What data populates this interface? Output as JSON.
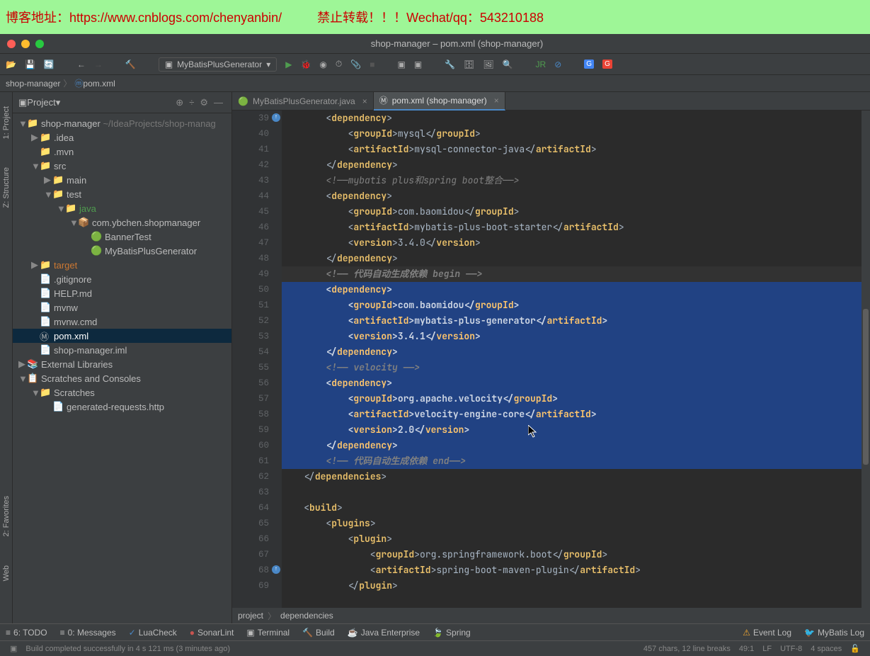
{
  "watermark": {
    "left": "博客地址：https://www.cnblogs.com/chenyanbin/",
    "right": "禁止转载！！！Wechat/qq：543210188"
  },
  "window_title": "shop-manager – pom.xml (shop-manager)",
  "run_config": "MyBatisPlusGenerator",
  "breadcrumb": {
    "root": "shop-manager",
    "file": "pom.xml"
  },
  "project_panel_title": "Project",
  "tree": [
    {
      "depth": 0,
      "arrow": "▼",
      "icon": "📁",
      "label": "shop-manager",
      "suffix": "  ~/IdeaProjects/shop-manag"
    },
    {
      "depth": 1,
      "arrow": "▶",
      "icon": "📁",
      "label": ".idea"
    },
    {
      "depth": 1,
      "arrow": "",
      "icon": "📁",
      "label": ".mvn"
    },
    {
      "depth": 1,
      "arrow": "▼",
      "icon": "📁",
      "label": "src"
    },
    {
      "depth": 2,
      "arrow": "▶",
      "icon": "📁",
      "label": "main"
    },
    {
      "depth": 2,
      "arrow": "▼",
      "icon": "📁",
      "label": "test"
    },
    {
      "depth": 3,
      "arrow": "▼",
      "icon": "📁",
      "label": "java",
      "green": true
    },
    {
      "depth": 4,
      "arrow": "▼",
      "icon": "📦",
      "label": "com.ybchen.shopmanager"
    },
    {
      "depth": 5,
      "arrow": "",
      "icon": "🟢",
      "label": "BannerTest"
    },
    {
      "depth": 5,
      "arrow": "",
      "icon": "🟢",
      "label": "MyBatisPlusGenerator"
    },
    {
      "depth": 1,
      "arrow": "▶",
      "icon": "📁",
      "label": "target",
      "orange": true
    },
    {
      "depth": 1,
      "arrow": "",
      "icon": "📄",
      "label": ".gitignore"
    },
    {
      "depth": 1,
      "arrow": "",
      "icon": "📄",
      "label": "HELP.md"
    },
    {
      "depth": 1,
      "arrow": "",
      "icon": "📄",
      "label": "mvnw"
    },
    {
      "depth": 1,
      "arrow": "",
      "icon": "📄",
      "label": "mvnw.cmd"
    },
    {
      "depth": 1,
      "arrow": "",
      "icon": "Ⓜ",
      "label": "pom.xml",
      "sel": true
    },
    {
      "depth": 1,
      "arrow": "",
      "icon": "📄",
      "label": "shop-manager.iml"
    },
    {
      "depth": 0,
      "arrow": "▶",
      "icon": "📚",
      "label": "External Libraries"
    },
    {
      "depth": 0,
      "arrow": "▼",
      "icon": "📋",
      "label": "Scratches and Consoles"
    },
    {
      "depth": 1,
      "arrow": "▼",
      "icon": "📁",
      "label": "Scratches"
    },
    {
      "depth": 2,
      "arrow": "",
      "icon": "📄",
      "label": "generated-requests.http"
    }
  ],
  "tabs": [
    {
      "label": "MyBatisPlusGenerator.java",
      "active": false,
      "icon": "🟢"
    },
    {
      "label": "pom.xml (shop-manager)",
      "active": true,
      "icon": "Ⓜ"
    }
  ],
  "code_lines": [
    {
      "n": 39,
      "mk": true,
      "html": "        <<1>dependency<0>>"
    },
    {
      "n": 40,
      "html": "            <<1>groupId<0>>mysql</<1>groupId<0>>"
    },
    {
      "n": 41,
      "html": "            <<1>artifactId<0>>mysql-connector-java</<1>artifactId<0>>"
    },
    {
      "n": 42,
      "html": "        </<1>dependency<0>>"
    },
    {
      "n": 43,
      "html": "        <2><!——mybatis plus和spring boot整合——><0>"
    },
    {
      "n": 44,
      "html": "        <<1>dependency<0>>"
    },
    {
      "n": 45,
      "html": "            <<1>groupId<0>>com.baomidou</<1>groupId<0>>"
    },
    {
      "n": 46,
      "html": "            <<1>artifactId<0>>mybatis-plus-boot-starter</<1>artifactId<0>>"
    },
    {
      "n": 47,
      "html": "            <<1>version<0>>3.4.0</<1>version<0>>"
    },
    {
      "n": 48,
      "html": "        </<1>dependency<0>>"
    },
    {
      "n": 49,
      "sel": true,
      "hl": true,
      "html": "        <2><!—— 代码自动生成依赖 begin ——><0>"
    },
    {
      "n": 50,
      "sel": true,
      "html": "        <<1>dependency<0>>"
    },
    {
      "n": 51,
      "sel": true,
      "html": "            <<1>groupId<0>>com.baomidou</<1>groupId<0>>"
    },
    {
      "n": 52,
      "sel": true,
      "html": "            <<1>artifactId<0>>mybatis-plus-generator</<1>artifactId<0>>"
    },
    {
      "n": 53,
      "sel": true,
      "html": "            <<1>version<0>>3.4.1</<1>version<0>>"
    },
    {
      "n": 54,
      "sel": true,
      "html": "        </<1>dependency<0>>"
    },
    {
      "n": 55,
      "sel": true,
      "html": "        <2><!—— velocity ——><0>"
    },
    {
      "n": 56,
      "sel": true,
      "html": "        <<1>dependency<0>>"
    },
    {
      "n": 57,
      "sel": true,
      "html": "            <<1>groupId<0>>org.apache.velocity</<1>groupId<0>>"
    },
    {
      "n": 58,
      "sel": true,
      "html": "            <<1>artifactId<0>>velocity-engine-core</<1>artifactId<0>>"
    },
    {
      "n": 59,
      "sel": true,
      "html": "            <<1>version<0>>2.0</<1>version<0>>"
    },
    {
      "n": 60,
      "sel": true,
      "html": "        </<1>dependency<0>>"
    },
    {
      "n": 61,
      "sel": true,
      "html": "        <2><!—— 代码自动生成依赖 end——><0>"
    },
    {
      "n": 62,
      "html": "    </<1>dependencies<0>>"
    },
    {
      "n": 63,
      "html": ""
    },
    {
      "n": 64,
      "html": "    <<1>build<0>>"
    },
    {
      "n": 65,
      "html": "        <<1>plugins<0>>"
    },
    {
      "n": 66,
      "html": "            <<1>plugin<0>>"
    },
    {
      "n": 67,
      "html": "                <<1>groupId<0>>org.springframework.boot</<1>groupId<0>>"
    },
    {
      "n": 68,
      "mk": true,
      "html": "                <<1>artifactId<0>>spring-boot-maven-plugin</<1>artifactId<0>>"
    },
    {
      "n": 69,
      "html": "            </<1>plugin<0>>"
    }
  ],
  "breadcrumb_bottom": [
    "project",
    "dependencies"
  ],
  "tool_windows": [
    {
      "icon": "≡",
      "label": "6: TODO"
    },
    {
      "icon": "≡",
      "label": "0: Messages"
    },
    {
      "icon": "✓",
      "label": "LuaCheck",
      "color": "#4a88c7"
    },
    {
      "icon": "●",
      "label": "SonarLint",
      "color": "#c75450"
    },
    {
      "icon": "▣",
      "label": "Terminal"
    },
    {
      "icon": "🔨",
      "label": "Build"
    },
    {
      "icon": "☕",
      "label": "Java Enterprise"
    },
    {
      "icon": "🍃",
      "label": "Spring"
    }
  ],
  "tool_right": [
    {
      "icon": "⚠",
      "label": "Event Log",
      "color": "#f0a732"
    },
    {
      "icon": "🐦",
      "label": "MyBatis Log",
      "color": "#c75450"
    }
  ],
  "statusbar": {
    "msg": "Build completed successfully in 4 s 121 ms (3 minutes ago)",
    "chars": "457 chars, 12 line breaks",
    "pos": "49:1",
    "sep": "LF",
    "enc": "UTF-8",
    "indent": "4 spaces"
  },
  "left_tabs": [
    "1: Project",
    "Z: Structure"
  ],
  "left_tabs2": [
    "2: Favorites",
    "Web"
  ]
}
